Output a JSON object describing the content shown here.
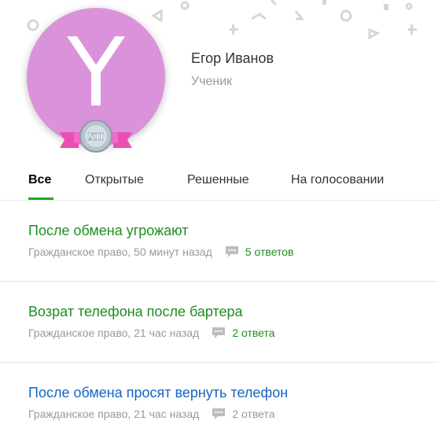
{
  "profile": {
    "avatar_letter": "Y",
    "rank_badge": "XII",
    "name": "Егор Иванов",
    "role": "Ученик",
    "avatar_color": "#da92da"
  },
  "tabs": [
    {
      "label": "Все",
      "active": true
    },
    {
      "label": "Открытые",
      "active": false
    },
    {
      "label": "Решенные",
      "active": false
    },
    {
      "label": "На голосовании",
      "active": false
    }
  ],
  "questions": [
    {
      "title": "После обмена угрожают",
      "category_time": "Гражданское право, 50 минут назад",
      "answers": "5 ответов",
      "title_color": "#1e8e1e",
      "answers_color": "#1e8e1e"
    },
    {
      "title": "Возрат телефона после бартера",
      "category_time": "Гражданское право, 21 час назад",
      "answers": "2 ответа",
      "title_color": "#1e8e1e",
      "answers_color": "#1e8e1e"
    },
    {
      "title": "После обмена просят вернуть телефон",
      "category_time": "Гражданское право, 21 час назад",
      "answers": "2 ответа",
      "title_color": "#1565c0",
      "answers_color": "#999999"
    }
  ],
  "colors": {
    "accent": "#22a622",
    "muted": "#999999"
  },
  "icons": [
    "comment-icon",
    "rank-badge-icon"
  ]
}
